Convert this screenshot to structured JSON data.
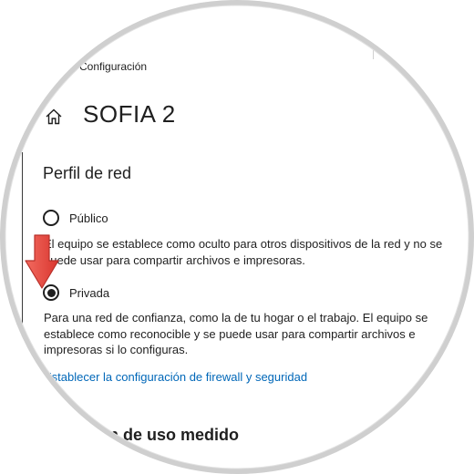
{
  "window": {
    "app_title": "Configuración"
  },
  "header": {
    "page_title": "SOFIA 2",
    "home_icon": "home-icon"
  },
  "network_profile": {
    "heading": "Perfil de red",
    "options": [
      {
        "label": "Público",
        "selected": false,
        "description": "El equipo se establece como oculto para otros dispositivos de la red y no se puede usar para compartir archivos e impresoras."
      },
      {
        "label": "Privada",
        "selected": true,
        "description": "Para una red de confianza, como la de tu hogar o el trabajo. El equipo se establece como reconocible y se puede usar para compartir archivos e impresoras si lo configuras."
      }
    ],
    "firewall_link": "Establecer la configuración de firewall y seguridad"
  },
  "metered": {
    "heading": "Conexión de uso medido"
  },
  "colors": {
    "accent_link": "#0067b8",
    "text": "#1f1f1f",
    "ring": "#c9c9c9",
    "arrow": "#e8403a"
  }
}
